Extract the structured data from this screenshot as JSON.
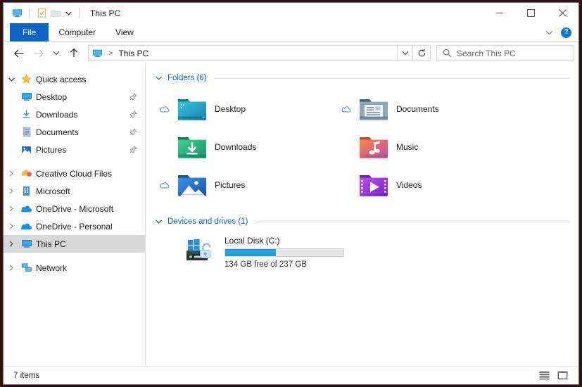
{
  "window": {
    "title": "This PC",
    "quick_access_toolbar": [
      {
        "name": "this-pc-icon",
        "label": "This PC"
      },
      {
        "name": "properties-icon",
        "label": "Properties"
      },
      {
        "name": "new-folder-icon",
        "label": "New folder"
      },
      {
        "name": "customize-caret-icon",
        "label": "Customize Quick Access Toolbar"
      }
    ],
    "controls": {
      "minimize": "Minimize",
      "maximize": "Maximize",
      "close": "Close"
    }
  },
  "ribbon": {
    "tabs": [
      {
        "label": "File",
        "active": true
      },
      {
        "label": "Computer",
        "active": false
      },
      {
        "label": "View",
        "active": false
      }
    ],
    "expand_label": "Expand the Ribbon",
    "help_label": "?"
  },
  "nav": {
    "back": "Back",
    "forward": "Forward",
    "recent": "Recent locations",
    "up": "Up",
    "breadcrumb": {
      "icon": "this-pc-icon",
      "separator": ">",
      "path": "This PC"
    },
    "address_caret": "Previous locations",
    "refresh": "Refresh",
    "search": {
      "placeholder": "Search This PC",
      "value": ""
    }
  },
  "sidebar": {
    "items": [
      {
        "label": "Quick access",
        "icon": "star-icon",
        "expanded": true,
        "level": 0,
        "pin": false,
        "selected": false
      },
      {
        "label": "Desktop",
        "icon": "desktop-folder-icon",
        "level": 1,
        "pin": true,
        "selected": false
      },
      {
        "label": "Downloads",
        "icon": "downloads-icon",
        "level": 1,
        "pin": true,
        "selected": false
      },
      {
        "label": "Documents",
        "icon": "documents-icon",
        "level": 1,
        "pin": true,
        "selected": false
      },
      {
        "label": "Pictures",
        "icon": "pictures-icon",
        "level": 1,
        "pin": true,
        "selected": false
      },
      {
        "label": "Creative Cloud Files",
        "icon": "creative-cloud-icon",
        "level": 0,
        "collapsed": true,
        "selected": false
      },
      {
        "label": "Microsoft",
        "icon": "microsoft-folder-icon",
        "level": 0,
        "collapsed": true,
        "selected": false
      },
      {
        "label": "OneDrive - Microsoft",
        "icon": "onedrive-icon",
        "level": 0,
        "collapsed": true,
        "selected": false
      },
      {
        "label": "OneDrive - Personal",
        "icon": "onedrive-icon",
        "level": 0,
        "collapsed": true,
        "selected": false
      },
      {
        "label": "This PC",
        "icon": "this-pc-icon",
        "level": 0,
        "collapsed": true,
        "selected": true
      },
      {
        "label": "Network",
        "icon": "network-icon",
        "level": 0,
        "collapsed": true,
        "selected": false
      }
    ]
  },
  "main": {
    "groups": [
      {
        "title": "Folders (6)",
        "expanded": true,
        "tiles": [
          {
            "label": "Desktop",
            "icon": "desktop-folder-icon",
            "cloud": true
          },
          {
            "label": "Documents",
            "icon": "documents-folder-icon",
            "cloud": true
          },
          {
            "label": "Downloads",
            "icon": "downloads-folder-icon",
            "cloud": false
          },
          {
            "label": "Music",
            "icon": "music-folder-icon",
            "cloud": false
          },
          {
            "label": "Pictures",
            "icon": "pictures-folder-icon",
            "cloud": true
          },
          {
            "label": "Videos",
            "icon": "videos-folder-icon",
            "cloud": false
          }
        ]
      },
      {
        "title": "Devices and drives (1)",
        "expanded": true,
        "drives": [
          {
            "name": "Local Disk (C:)",
            "icon": "windows-drive-bitlocker-icon",
            "free_text": "134 GB free of 237 GB",
            "free_gb": 134,
            "total_gb": 237,
            "used_percent": 43
          }
        ]
      }
    ]
  },
  "status": {
    "item_count": "7 items",
    "views": [
      {
        "name": "details-view-button",
        "label": "Details view"
      },
      {
        "name": "large-icons-view-button",
        "label": "Large icons view"
      }
    ]
  },
  "colors": {
    "accent": "#0b64c6",
    "group_header": "#1464b4",
    "progress_fill": "#26a0da",
    "selection": "#d8d8d8"
  }
}
